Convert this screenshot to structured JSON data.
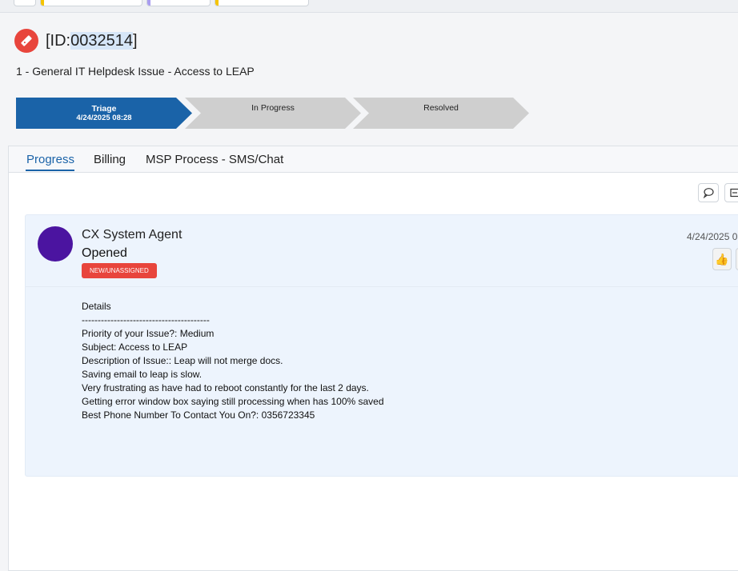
{
  "colors": {
    "accent": "#1a63a8",
    "ticket_icon_bg": "#e8453c",
    "badge_bg": "#e8453c",
    "avatar_bg": "#4b14a0",
    "card_bg": "#edf4fd",
    "stage_inactive": "#cfcfcf"
  },
  "ticket": {
    "id_prefix": "[ID:",
    "id_number": "0032514",
    "id_suffix": "]",
    "title": "1 - General IT Helpdesk Issue - Access to LEAP",
    "icon": "ticket-icon"
  },
  "stages": [
    {
      "name": "Triage",
      "date": "4/24/2025 08:28",
      "active": true
    },
    {
      "name": "In Progress",
      "active": false
    },
    {
      "name": "Resolved",
      "active": false
    }
  ],
  "tabs": [
    {
      "label": "Progress",
      "active": true
    },
    {
      "label": "Billing",
      "active": false
    },
    {
      "label": "MSP Process - SMS/Chat",
      "active": false
    }
  ],
  "toolbar": {
    "comment_icon": "comment-icon",
    "compose_icon": "compose-icon"
  },
  "entry": {
    "agent": "CX System Agent",
    "action": "Opened",
    "status_badge": "NEW/UNASSIGNED",
    "timestamp": "4/24/2025 0",
    "like_icon": "thumbs-up-icon",
    "details": [
      "Details",
      "----------------------------------------",
      "Priority of your Issue?: Medium",
      "Subject: Access to LEAP",
      "Description of Issue:: Leap will not merge docs.",
      "Saving email to leap is slow.",
      "Very frustrating as have had to reboot constantly for the last 2 days.",
      "Getting error window box saying still processing when has 100% saved",
      "Best Phone Number To Contact You On?: 0356723345"
    ]
  }
}
